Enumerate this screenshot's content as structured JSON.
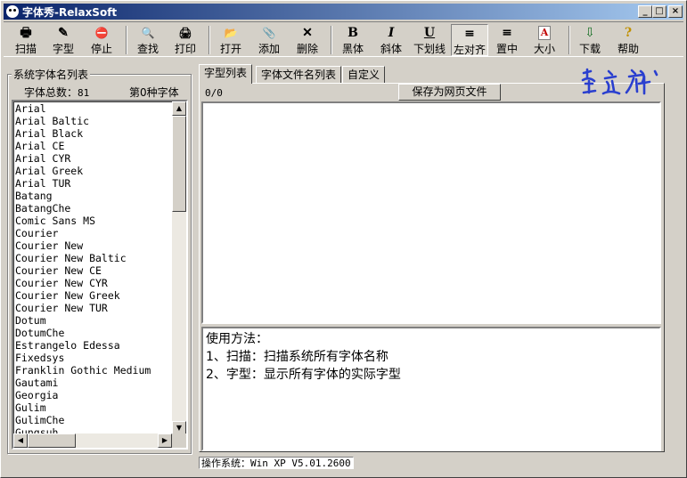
{
  "window": {
    "title": "字体秀-RelaxSoft",
    "controls": {
      "minimize": "_",
      "maximize": "□",
      "close": "×"
    }
  },
  "toolbar": {
    "items": [
      {
        "label": "扫描",
        "icon": "scanner-icon",
        "glyph": "🖶"
      },
      {
        "label": "字型",
        "icon": "font-type-icon",
        "glyph": "✎"
      },
      {
        "label": "停止",
        "icon": "stop-sign-icon",
        "glyph": "⛔"
      },
      {
        "label": "查找",
        "icon": "find-icon",
        "glyph": "🔍"
      },
      {
        "label": "打印",
        "icon": "printer-icon",
        "glyph": "🖨"
      },
      {
        "label": "打开",
        "icon": "open-folder-icon",
        "glyph": "📂"
      },
      {
        "label": "添加",
        "icon": "paperclip-icon",
        "glyph": "📎"
      },
      {
        "label": "删除",
        "icon": "delete-x-icon",
        "glyph": "✕"
      },
      {
        "label": "黑体",
        "icon": "bold-icon",
        "glyph": "B"
      },
      {
        "label": "斜体",
        "icon": "italic-icon",
        "glyph": "I"
      },
      {
        "label": "下划线",
        "icon": "underline-icon",
        "glyph": "U"
      },
      {
        "label": "左对齐",
        "icon": "align-left-icon",
        "glyph": "≡"
      },
      {
        "label": "置中",
        "icon": "align-center-icon",
        "glyph": "≡"
      },
      {
        "label": "大小",
        "icon": "font-size-icon",
        "glyph": "A"
      },
      {
        "label": "下载",
        "icon": "download-icon",
        "glyph": "⇩"
      },
      {
        "label": "帮助",
        "icon": "help-icon",
        "glyph": "?"
      }
    ]
  },
  "sidebar": {
    "group_title": "系统字体名列表",
    "count_label": "字体总数：",
    "count_value": "81",
    "index_label": "第0种字体",
    "fonts": [
      "Arial",
      "Arial Baltic",
      "Arial Black",
      "Arial CE",
      "Arial CYR",
      "Arial Greek",
      "Arial TUR",
      "Batang",
      "BatangChe",
      "Comic Sans MS",
      "Courier",
      "Courier New",
      "Courier New Baltic",
      "Courier New CE",
      "Courier New CYR",
      "Courier New Greek",
      "Courier New TUR",
      "Dotum",
      "DotumChe",
      "Estrangelo Edessa",
      "Fixedsys",
      "Franklin Gothic Medium",
      "Gautami",
      "Georgia",
      "Gulim",
      "GulimChe",
      "Gungsuh"
    ]
  },
  "tabs": [
    {
      "label": "字型列表"
    },
    {
      "label": "字体文件名列表"
    },
    {
      "label": "自定义"
    }
  ],
  "main": {
    "page_counter": "0/0",
    "save_button": "保存为网页文件",
    "usage_lines": [
      "使用方法：",
      "1、扫描：扫描系统所有字体名称",
      "2、字型：显示所有字体的实际字型"
    ]
  },
  "logo": {
    "text": "笪远辉",
    "color": "#2a3fcf"
  },
  "status": {
    "os": "操作系统：Win XP V5.01.2600"
  }
}
